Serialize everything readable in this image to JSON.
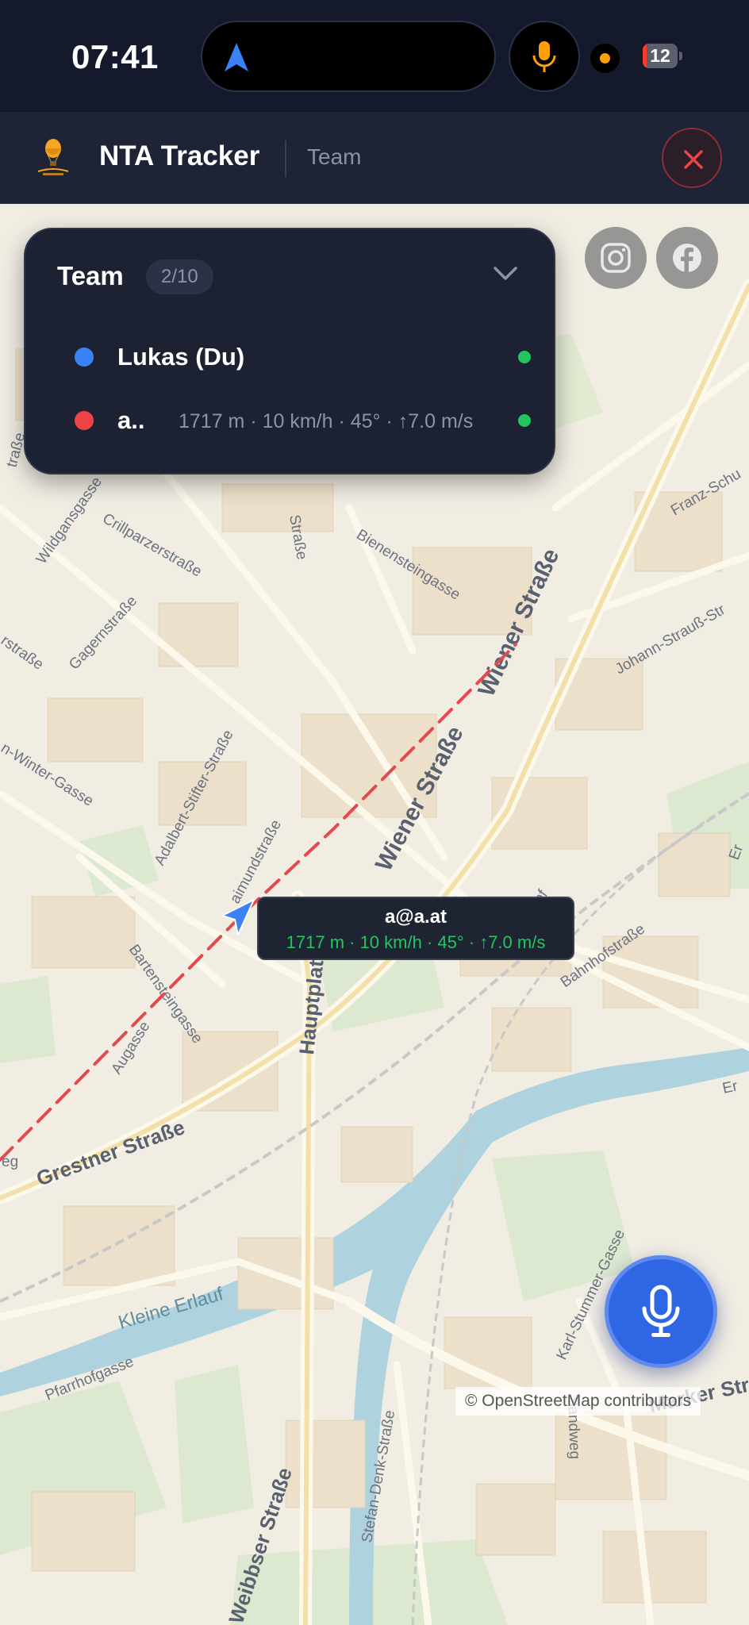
{
  "status_bar": {
    "time": "07:41",
    "battery_level": "12",
    "battery_fraction": 0.12,
    "icons": [
      "location-arrow-icon",
      "microphone-icon",
      "recording-dot-icon",
      "battery-icon"
    ]
  },
  "header": {
    "app_title": "NTA Tracker",
    "section": "Team",
    "logo_icon": "hot-air-balloon-logo-icon",
    "close_icon": "close-icon"
  },
  "team_panel": {
    "title": "Team",
    "count": "2/10",
    "toggle_icon": "chevron-down-icon",
    "members": [
      {
        "name": "Lukas (Du)",
        "stats": "",
        "color": "#3b82f6",
        "online": true
      },
      {
        "name": "a..",
        "stats": "1717 m · 10 km/h · 45° · ↑7.0 m/s",
        "color": "#ef4444",
        "online": true
      }
    ]
  },
  "social": [
    {
      "icon": "instagram-icon"
    },
    {
      "icon": "facebook-icon"
    }
  ],
  "map": {
    "tooltip_name": "a@a.at",
    "tooltip_stats": "1717 m · 10 km/h · 45° · ↑7.0 m/s",
    "attribution": "© OpenStreetMap contributors",
    "route_color": "#e5484d",
    "street_labels": [
      "Wiener Straße",
      "Wiener Straße",
      "Hauptplatz",
      "Grestner Straße",
      "Kleine Erlauf",
      "Bienensteingasse",
      "Crillparzerstraße",
      "Gagernstraße",
      "Wildgansgasse",
      "Adalbert-Stifter-Straße",
      "Bartensteingasse",
      "Augasse",
      "Bahnhofstraße",
      "Bahnhof",
      "Johann-Strauß-Str",
      "Franz-Schu",
      "Karl-Stummer-Gasse",
      "Sandweg",
      "Stefan-Denk-Straße",
      "Pfarrhofgasse",
      "Weibbser Straße",
      "n-Winter-Gasse",
      "rstraße",
      "traße",
      "Straße",
      "aimundstraße",
      "Marker Str",
      "eg",
      "Er",
      "Er"
    ]
  },
  "voice_button": {
    "icon": "microphone-icon"
  }
}
